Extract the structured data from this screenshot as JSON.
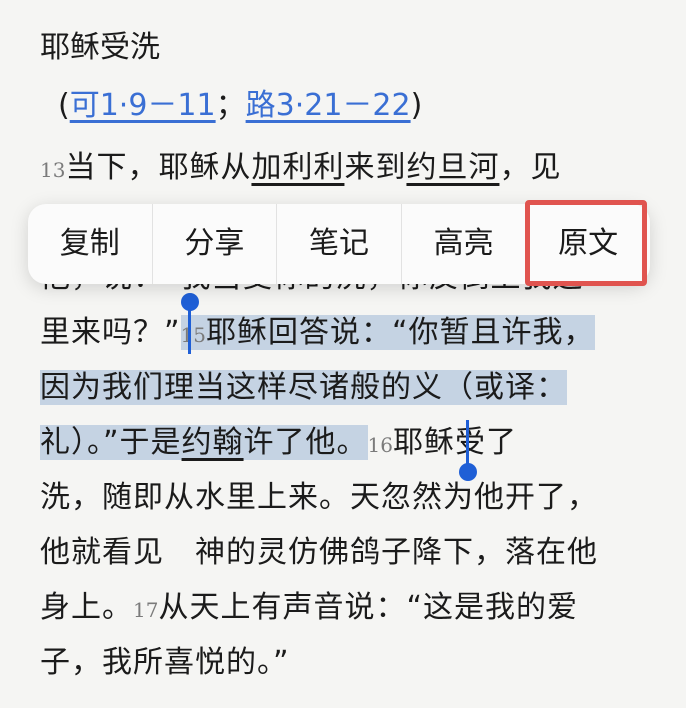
{
  "passage": {
    "title": "耶稣受洗",
    "refs": {
      "open": "(",
      "ref1": "可1·9－11",
      "sep": "；",
      "ref2": "路3·21－22",
      "close": ")"
    },
    "lines": {
      "l1_num": "13",
      "l1_a": "当下，耶稣从",
      "l1_place1": "加利利",
      "l1_b": "来到",
      "l1_place2": "约旦河",
      "l1_c": "，见",
      "l2": "他，说：“我当受你的洗，你反倒上我这",
      "l3_a": "里来吗？”",
      "l3_num": "15",
      "l3_b": "耶稣回答说：“你暂且许我，",
      "l4": "因为我们理当这样尽诸般的义（或译：",
      "l5_a": "礼）。”于是",
      "l5_place": "约翰",
      "l5_b": "许了他。",
      "l5_num": "16",
      "l5_c": "耶稣受了",
      "l6": "洗，随即从水里上来。天忽然为他开了，",
      "l7": "他就看见　神的灵仿佛鸽子降下，落在他",
      "l8_a": "身上。",
      "l8_num": "17",
      "l8_b": "从天上有声音说：“这是我的爱",
      "l9": "子，我所喜悦的。”"
    }
  },
  "context_menu": {
    "items": [
      "复制",
      "分享",
      "笔记",
      "高亮",
      "原文"
    ],
    "highlighted_item": "原文"
  },
  "colors": {
    "selection": "#c5d3e3",
    "handle": "#1f5fd6",
    "link": "#3a6fd4",
    "callout": "#e0544f"
  }
}
